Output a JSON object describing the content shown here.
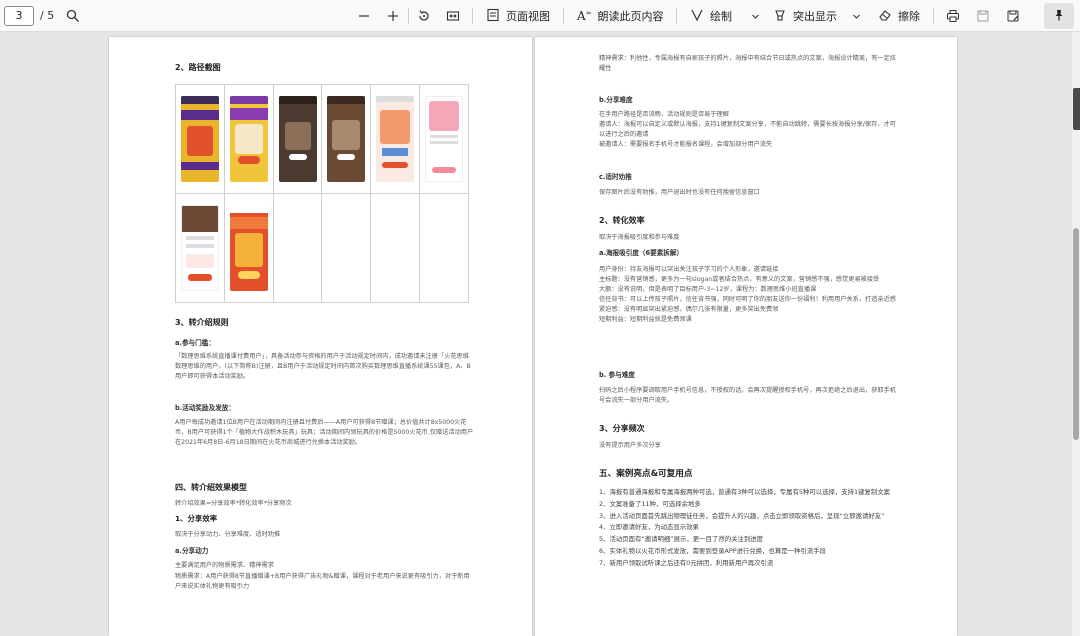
{
  "toolbar": {
    "page_current": "3",
    "page_total": "/ 5",
    "page_view_label": "页面视图",
    "read_aloud_label": "朗读此页内容",
    "draw_label": "绘制",
    "highlight_label": "突出显示",
    "erase_label": "擦除",
    "icons": [
      "search-icon",
      "zoom-out-icon",
      "zoom-in-icon",
      "rotate-icon",
      "fit-page-icon",
      "page-view-icon",
      "read-aloud-icon",
      "draw-icon",
      "highlight-icon",
      "erase-icon",
      "print-icon",
      "save-icon",
      "save-as-icon",
      "pin-icon"
    ]
  },
  "left_page": {
    "sec2_title": "2、路径截图",
    "sec3_title": "3、转介绍规则",
    "a_title": "a.参与门槛：",
    "a_text": "「数理思维系统直播课付费用户」，具备活动参与资格的用户于活动规定时间内，成功邀请未注册「火花思维数理思维的用户，(以下简称B)注册，且B用户于活动规定时间内首次购买数理思维直播系统课55课包，A、B用户即可获得本活动奖励。",
    "b_title": "b.活动奖励及发放：",
    "b_text": "A用户每成功邀请1位B用户在活动期间内注册且付费后——A用户可获得8节赠课；总价值共计8x5000火花币，B用户可获得1个「植物大作战积木玩具」玩具；活动期间内领玩具的价格是5000火花币,仅赠送活动用户在2021年6月8日-6月18日期间在火花币商城进行兑换本活动奖励。",
    "sec4_title": "四、转介绍效果模型",
    "sec4_text": "转介绍效果=分享效率*转化效率*分享频次",
    "s1_title": "1、分享效率",
    "s1_text": "取决于分享动力、分享难度、适时劝推",
    "s1a_title": "a.分享动力",
    "s1a_text1": "主要满足用户的物质需求、精神需求",
    "s1a_text2": "物质需求：A用户获得8节直播赠课+B用户获得广告礼物&赠课，课程对于老用户来说更有吸引力，对于新用户来说实体礼物更有吸引力"
  },
  "right_page": {
    "p1": "精神需求：利他性，专属海报有自家孩子的照片，海报中有结合节日或热点的文案，海报设计精美，有一定炫耀性",
    "b_title": "b.分享难度",
    "b_lines": [
      "在手用户路径是否流畅，活动规则是否易于理解",
      "邀请人：海报可以自定义或默认海报，支持1键复制文案分享，不能自动跳转，需要长按海报分享/保存，才可以进行之后的邀请",
      "被邀请人：需要报名手机号才能报名课程，会增加部分用户流失"
    ],
    "c_title": "c.适时劝推",
    "c_text": "保存图片后没有劝推，用户退出时也没有任何挽留信息窗口",
    "s2_title": "2、转化效率",
    "s2_text": "取决于海报吸引度和参与难度",
    "a2_title": "a.海报吸引度（6要素拆解）",
    "a2_lines": [
      "用户身份：持友海报可以突出关注孩子学习的个人形象，邀请链接",
      "主标题：没有营销感，更多为一句slogan或者结合热点，有意义的文案，营销感不强，感觉更易被接受",
      "大额：没有说明，但是表明了目标用户-3~12岁，课程为：数理思维小班直播课",
      "信任背书：可以上传孩子照片，信任背书强，同时可明了你的朋友送你一份福利！利用用户关系，打造亲近感",
      "紧迫感：没有明显突出紧迫感，偶尔几张有限量，更多突出免费领",
      "短期利益：短期利益就是免费领课"
    ],
    "b2_title": "b. 参与难度",
    "b2_text": "扫码之后小程序要调取用户手机号信息，不授权的话，会再次提醒授权手机号，再次拒绝之后退出，获取手机号会流失一部分用户流失。",
    "s3_title": "3、分享频次",
    "s3_text": "没有提示用户多次分享",
    "sec5_title": "五、案例亮点&可复用点",
    "sec5_items": [
      "1、海报有普通海报和专属海报两种可选，普通有3种可以选择，专属有5种可以选择，支持1键复制文案",
      "2、文案准备了11种，可选择余地多",
      "3、进入活动页面首先跳出物理徒任务，会提升人的兴趣，点击立即领取资格后，呈现“立即邀请好友”",
      "4、立即邀请好友，为动态显示效果",
      "5、活动页面有“邀请明细”展示，更一目了然的关注到进度",
      "6、实体礼物以火花币形式发放，需要到登录APP进行兑换，也算是一种引流手段",
      "7、新用户领取试听课之后还有0元拼团，利用新用户再次引流"
    ]
  },
  "colors": {
    "toolbar_bg": "#f9f9f9",
    "canvas_bg": "#e6e6e6",
    "page_bg": "#ffffff",
    "poster_gold": "#e9b62b",
    "poster_purple": "#5a2d8c",
    "poster_orange": "#e2502c",
    "poster_brown": "#6b4a33",
    "poster_pink": "#f4a7b9"
  }
}
